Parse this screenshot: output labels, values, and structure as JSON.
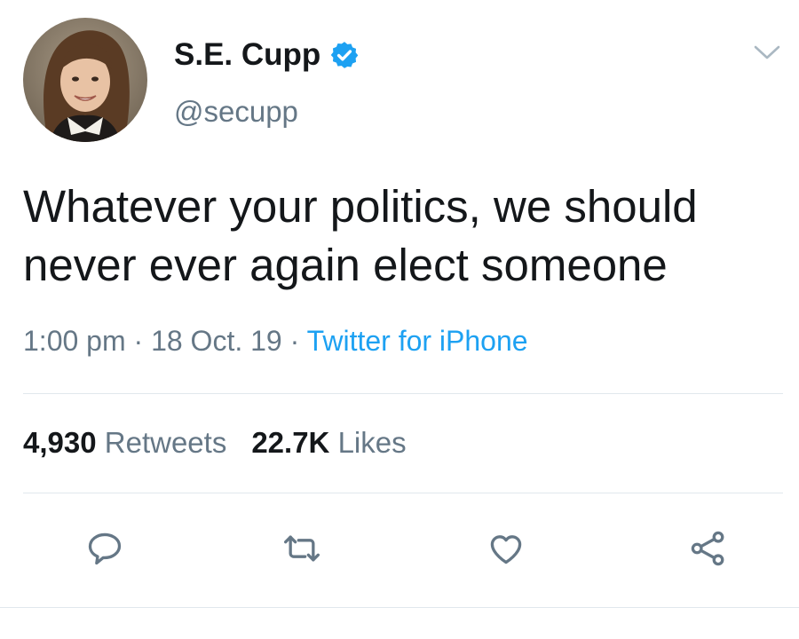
{
  "author": {
    "display_name": "S.E. Cupp",
    "handle": "@secupp",
    "verified": true,
    "avatar_icon": "profile-photo"
  },
  "tweet": {
    "text": "Whatever your politics, we should never ever again elect someone",
    "time": "1:00 pm",
    "separator": " · ",
    "date": "18 Oct. 19",
    "source": "Twitter for iPhone"
  },
  "stats": {
    "retweets_count": "4,930",
    "retweets_label": "Retweets",
    "likes_count": "22.7K",
    "likes_label": "Likes"
  },
  "actions": {
    "reply_icon": "reply-icon",
    "retweet_icon": "retweet-icon",
    "like_icon": "heart-icon",
    "share_icon": "share-icon"
  },
  "colors": {
    "text": "#14171a",
    "secondary": "#657786",
    "accent": "#1da1f2",
    "divider": "#e1e8ed"
  }
}
